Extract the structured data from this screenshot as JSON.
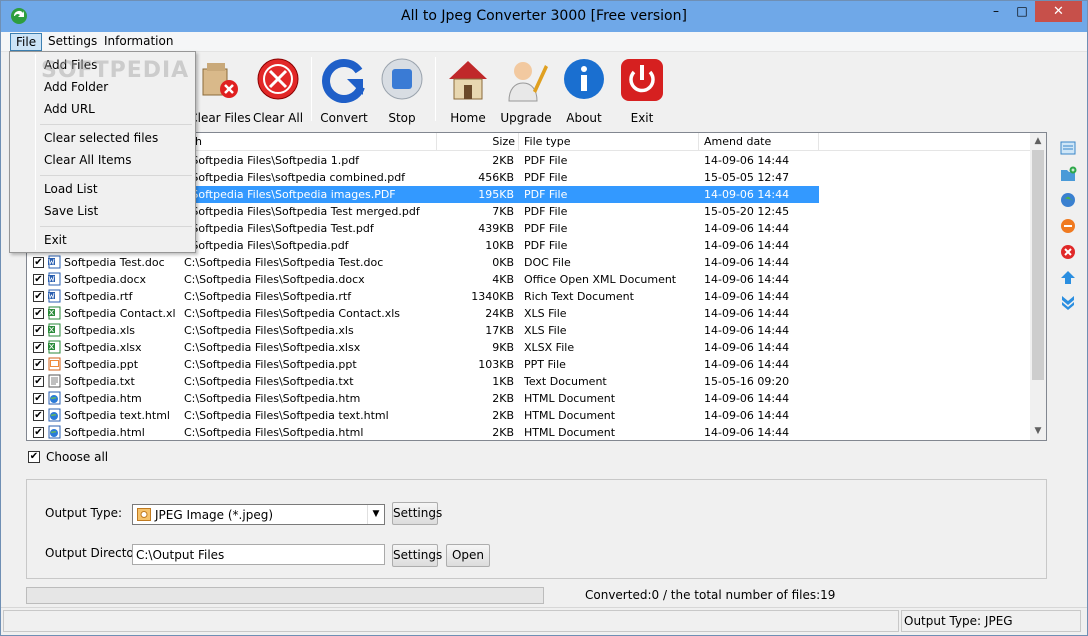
{
  "window": {
    "title": "All to Jpeg Converter 3000 [Free version]",
    "minimize": "–",
    "maximize": "□",
    "close": "✕"
  },
  "menu": [
    {
      "label": "File",
      "active": true
    },
    {
      "label": "Settings"
    },
    {
      "label": "Information"
    }
  ],
  "file_menu": {
    "items": [
      "Add Files",
      "Add Folder",
      "Add URL",
      "Clear selected files",
      "Clear All Items",
      "Load List",
      "Save List",
      "Exit"
    ]
  },
  "watermark": "SOFTPEDIA",
  "toolbar": {
    "clear_files": "Clear Files",
    "clear_all": "Clear All",
    "convert": "Convert",
    "stop": "Stop",
    "home": "Home",
    "upgrade": "Upgrade",
    "about": "About",
    "exit": "Exit"
  },
  "columns": {
    "path": "ath",
    "size": "Size",
    "type": "File type",
    "date": "Amend date"
  },
  "rows": [
    {
      "name": "",
      "path": ":\\Softpedia Files\\Softpedia 1.pdf",
      "size": "2KB",
      "type": "PDF File",
      "date": "14-09-06 14:44",
      "icon": "pdf-icon"
    },
    {
      "name": "",
      "path": ":\\Softpedia Files\\softpedia combined.pdf",
      "size": "456KB",
      "type": "PDF File",
      "date": "15-05-05 12:47",
      "icon": "pdf-icon"
    },
    {
      "name": "",
      "path": ":\\Softpedia Files\\Softpedia images.PDF",
      "size": "195KB",
      "type": "PDF File",
      "date": "14-09-06 14:44",
      "icon": "pdf-icon",
      "selected": true
    },
    {
      "name": "",
      "path": ":\\Softpedia Files\\Softpedia Test merged.pdf",
      "size": "7KB",
      "type": "PDF File",
      "date": "15-05-20 12:45",
      "icon": "pdf-icon"
    },
    {
      "name": "",
      "path": ":\\Softpedia Files\\Softpedia Test.pdf",
      "size": "439KB",
      "type": "PDF File",
      "date": "14-09-06 14:44",
      "icon": "pdf-icon"
    },
    {
      "name": "",
      "path": ":\\Softpedia Files\\Softpedia.pdf",
      "size": "10KB",
      "type": "PDF File",
      "date": "14-09-06 14:44",
      "icon": "pdf-icon"
    },
    {
      "name": "Softpedia Test.doc",
      "path": "C:\\Softpedia Files\\Softpedia Test.doc",
      "size": "0KB",
      "type": "DOC File",
      "date": "14-09-06 14:44",
      "icon": "word-icon"
    },
    {
      "name": "Softpedia.docx",
      "path": "C:\\Softpedia Files\\Softpedia.docx",
      "size": "4KB",
      "type": "Office Open XML Document",
      "date": "14-09-06 14:44",
      "icon": "word-icon"
    },
    {
      "name": "Softpedia.rtf",
      "path": "C:\\Softpedia Files\\Softpedia.rtf",
      "size": "1340KB",
      "type": "Rich Text Document",
      "date": "14-09-06 14:44",
      "icon": "word-icon"
    },
    {
      "name": "Softpedia Contact.xls",
      "path": "C:\\Softpedia Files\\Softpedia Contact.xls",
      "size": "24KB",
      "type": "XLS File",
      "date": "14-09-06 14:44",
      "icon": "excel-icon"
    },
    {
      "name": "Softpedia.xls",
      "path": "C:\\Softpedia Files\\Softpedia.xls",
      "size": "17KB",
      "type": "XLS File",
      "date": "14-09-06 14:44",
      "icon": "excel-icon"
    },
    {
      "name": "Softpedia.xlsx",
      "path": "C:\\Softpedia Files\\Softpedia.xlsx",
      "size": "9KB",
      "type": "XLSX File",
      "date": "14-09-06 14:44",
      "icon": "excel-icon"
    },
    {
      "name": "Softpedia.ppt",
      "path": "C:\\Softpedia Files\\Softpedia.ppt",
      "size": "103KB",
      "type": "PPT File",
      "date": "14-09-06 14:44",
      "icon": "ppt-icon"
    },
    {
      "name": "Softpedia.txt",
      "path": "C:\\Softpedia Files\\Softpedia.txt",
      "size": "1KB",
      "type": "Text Document",
      "date": "15-05-16 09:20",
      "icon": "txt-icon"
    },
    {
      "name": "Softpedia.htm",
      "path": "C:\\Softpedia Files\\Softpedia.htm",
      "size": "2KB",
      "type": "HTML Document",
      "date": "14-09-06 14:44",
      "icon": "html-icon"
    },
    {
      "name": "Softpedia text.html",
      "path": "C:\\Softpedia Files\\Softpedia text.html",
      "size": "2KB",
      "type": "HTML Document",
      "date": "14-09-06 14:44",
      "icon": "html-icon"
    },
    {
      "name": "Softpedia.html",
      "path": "C:\\Softpedia Files\\Softpedia.html",
      "size": "2KB",
      "type": "HTML Document",
      "date": "14-09-06 14:44",
      "icon": "html-icon"
    }
  ],
  "choose_all": "Choose all",
  "output": {
    "type_label": "Output Type:",
    "type_value": "JPEG Image (*.jpeg)",
    "dir_label": "Output Directory:",
    "dir_value": "C:\\Output Files",
    "settings": "Settings",
    "open": "Open"
  },
  "converted_text": "Converted:0  /  the total number of files:19",
  "status_output_type": "Output Type: JPEG"
}
